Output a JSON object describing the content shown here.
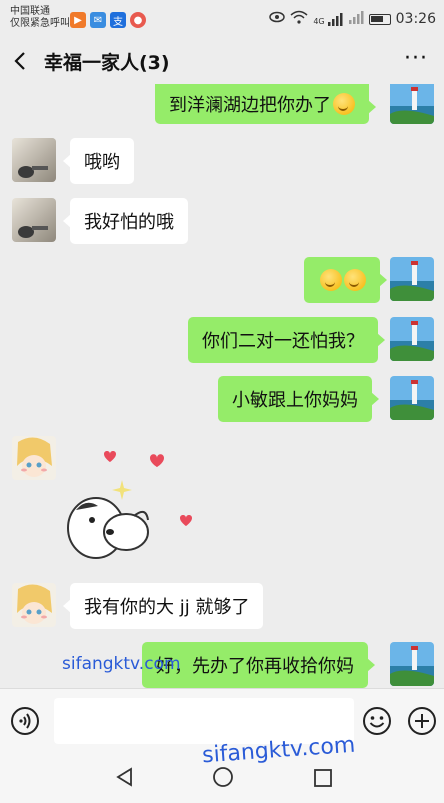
{
  "status_bar": {
    "carrier_line1": "中国联通",
    "carrier_line2": "仅限紧急呼叫",
    "network": "4G",
    "time": "03:26"
  },
  "header": {
    "title": "幸福一家人(3)",
    "more": "···"
  },
  "messages": [
    {
      "side": "right",
      "text": "到洋澜湖边把你办了",
      "emoji_count": 1
    },
    {
      "side": "left",
      "text": "哦哟",
      "sender": "member-1"
    },
    {
      "side": "left",
      "text": "我好怕的哦",
      "sender": "member-1"
    },
    {
      "side": "right",
      "text": "",
      "emoji_count": 2
    },
    {
      "side": "right",
      "text": "你们二对一还怕我？"
    },
    {
      "side": "right",
      "text": "小敏跟上你妈妈"
    },
    {
      "side": "left",
      "type": "sticker",
      "sender": "member-2"
    },
    {
      "side": "left",
      "text": "我有你的大 jj 就够了",
      "sender": "member-2"
    },
    {
      "side": "right",
      "text": "好，先办了你再收拾你妈"
    }
  ],
  "watermarks": [
    "sifangktv.com",
    "sifangktv.com"
  ],
  "colors": {
    "background": "#ededed",
    "bubble_self": "#95ec69",
    "bubble_other": "#ffffff",
    "watermark": "#2a5bd7"
  },
  "icons": {
    "back": "back-arrow-icon",
    "more": "more-icon",
    "voice": "voice-icon",
    "emoji": "smile-icon",
    "plus": "plus-icon"
  }
}
